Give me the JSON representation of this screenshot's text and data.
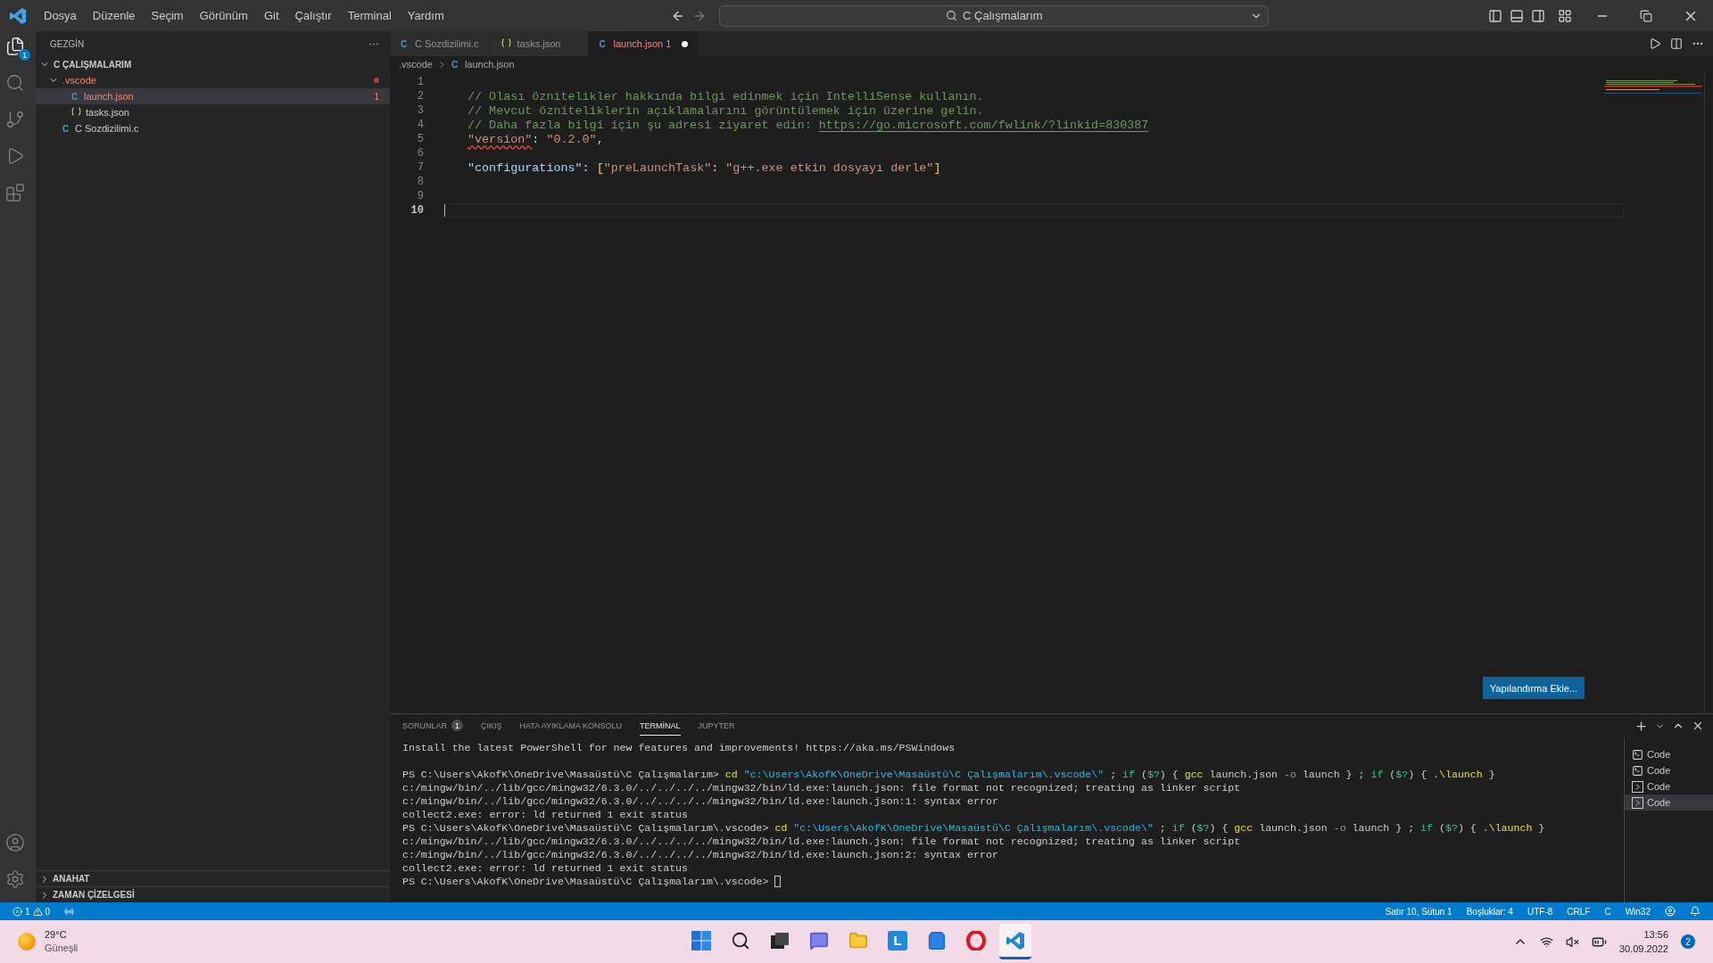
{
  "title_bar": {
    "menu": [
      "Dosya",
      "Düzenle",
      "Seçim",
      "Görünüm",
      "Git",
      "Çalıştır",
      "Terminal",
      "Yardım"
    ],
    "search": "C Çalışmalarım"
  },
  "activity_bar": {
    "items": [
      {
        "kind": "files",
        "selected": true,
        "badge": "1"
      },
      {
        "kind": "search",
        "selected": false
      },
      {
        "kind": "git",
        "selected": false
      },
      {
        "kind": "debug",
        "selected": false
      },
      {
        "kind": "extensions",
        "selected": false
      }
    ]
  },
  "sidebar": {
    "title": "GEZGİN",
    "more": "···",
    "root": {
      "label": "C ÇALIŞMALARIM",
      "expanded": true,
      "children": [
        {
          "kind": "folder",
          "label": ".vscode",
          "expanded": true,
          "error": true,
          "children": [
            {
              "kind": "c",
              "icon": "C",
              "label": "launch.json",
              "selected": true,
              "error": true,
              "badge": "1"
            },
            {
              "kind": "json",
              "label": "tasks.json",
              "selected": false,
              "error": false
            }
          ]
        },
        {
          "kind": "c",
          "icon": "C",
          "label": "C Sozdizilimi.c",
          "selected": false,
          "error": false
        }
      ]
    },
    "sections": [
      {
        "label": "ANAHAT",
        "expanded": false
      },
      {
        "label": "ZAMAN ÇİZELGESİ",
        "expanded": false
      }
    ]
  },
  "tabs": [
    {
      "kind": "c",
      "icon": "C",
      "label": "C Sozdizilimi.c",
      "selected": false,
      "error": false,
      "modified": false
    },
    {
      "kind": "json",
      "label": "tasks.json",
      "selected": false,
      "error": false,
      "modified": false
    },
    {
      "kind": "c",
      "icon": "C",
      "label": "launch.json",
      "badge": "1",
      "selected": true,
      "error": true,
      "modified": true
    }
  ],
  "breadcrumb": [
    {
      "kind": "folder",
      "label": ".vscode"
    },
    {
      "kind": "c",
      "icon": "C",
      "label": "launch.json"
    }
  ],
  "editor": {
    "lines": [
      {
        "number": "1",
        "current": false
      },
      {
        "number": "2",
        "current": false,
        "segments": [
          {
            "kind": "comment",
            "text": "// Olası öznitelikler hakkında bilgi edinmek için IntelliSense kullanın."
          }
        ]
      },
      {
        "number": "3",
        "current": false,
        "segments": [
          {
            "kind": "comment",
            "text": "// Mevcut özniteliklerin açıklamalarını görüntülemek için üzerine gelin."
          }
        ]
      },
      {
        "number": "4",
        "current": false,
        "segments": [
          {
            "kind": "comment",
            "text": "// Daha fazla bilgi için şu adresi ziyaret edin: "
          },
          {
            "kind": "link",
            "text": "https://go.microsoft.com/fwlink/?linkid=830387"
          }
        ]
      },
      {
        "number": "5",
        "current": false,
        "segments": [
          {
            "kind": "error_key",
            "text": "\"version\""
          },
          {
            "kind": "punct",
            "text": ": "
          },
          {
            "kind": "string",
            "text": "\"0.2.0\""
          },
          {
            "kind": "punct",
            "text": ","
          }
        ]
      },
      {
        "number": "6",
        "current": false
      },
      {
        "number": "7",
        "current": false,
        "segments": [
          {
            "kind": "key",
            "text": "\"configurations\""
          },
          {
            "kind": "punct",
            "text": ": "
          },
          {
            "kind": "bracket",
            "text": "["
          },
          {
            "kind": "string",
            "text": "\"preLaunchTask\""
          },
          {
            "kind": "punct",
            "text": ": "
          },
          {
            "kind": "string",
            "text": "\"g++.exe etkin dosyayı derle\""
          },
          {
            "kind": "bracket",
            "text": "]"
          }
        ]
      },
      {
        "number": "8",
        "current": false
      },
      {
        "number": "9",
        "current": false
      },
      {
        "number": "10",
        "current": true
      }
    ],
    "action_button": "Yapılandırma Ekle..."
  },
  "panel": {
    "tabs": [
      {
        "label": "SORUNLAR",
        "badge": "1",
        "selected": false
      },
      {
        "label": "ÇIKIŞ",
        "selected": false
      },
      {
        "label": "HATA AYIKLAMA KONSOLU",
        "selected": false
      },
      {
        "label": "TERMİNAL",
        "selected": true
      },
      {
        "label": "JUPYTER",
        "selected": false
      }
    ],
    "terminal_lines": [
      {
        "kind": "text",
        "segments": [
          {
            "kind": "plain",
            "text": "Install the latest PowerShell for new features and improvements! https://aka.ms/PSWindows"
          }
        ]
      },
      {
        "kind": "blank"
      },
      {
        "kind": "text",
        "segments": [
          {
            "kind": "plain",
            "text": "PS C:\\Users\\AkofK\\OneDrive\\Masaüstü\\C Çalışmalarım> "
          },
          {
            "kind": "cmd",
            "text": "cd"
          },
          {
            "kind": "str",
            "text": " \"c:\\Users\\AkofK\\OneDrive\\Masaüstü\\C Çalışmalarım\\.vscode\\\""
          },
          {
            "kind": "plain",
            "text": " ; "
          },
          {
            "kind": "kw",
            "text": "if"
          },
          {
            "kind": "plain",
            "text": " ("
          },
          {
            "kind": "kw",
            "text": "$?"
          },
          {
            "kind": "plain",
            "text": ") { "
          },
          {
            "kind": "cmd",
            "text": "gcc"
          },
          {
            "kind": "plain",
            "text": " launch.json "
          },
          {
            "kind": "flag",
            "text": "-o"
          },
          {
            "kind": "plain",
            "text": " launch } ; "
          },
          {
            "kind": "kw",
            "text": "if"
          },
          {
            "kind": "plain",
            "text": " ("
          },
          {
            "kind": "kw",
            "text": "$?"
          },
          {
            "kind": "plain",
            "text": ") { "
          },
          {
            "kind": "cmd",
            "text": ".\\launch"
          },
          {
            "kind": "plain",
            "text": " }"
          }
        ]
      },
      {
        "kind": "text",
        "segments": [
          {
            "kind": "plain",
            "text": "c:/mingw/bin/../lib/gcc/mingw32/6.3.0/../../../../mingw32/bin/ld.exe:launch.json: file format not recognized; treating as linker script"
          }
        ]
      },
      {
        "kind": "text",
        "segments": [
          {
            "kind": "plain",
            "text": "c:/mingw/bin/../lib/gcc/mingw32/6.3.0/../../../../mingw32/bin/ld.exe:launch.json:1: syntax error"
          }
        ]
      },
      {
        "kind": "text",
        "segments": [
          {
            "kind": "plain",
            "text": "collect2.exe: error: ld returned 1 exit status"
          }
        ]
      },
      {
        "kind": "text",
        "segments": [
          {
            "kind": "plain",
            "text": "PS C:\\Users\\AkofK\\OneDrive\\Masaüstü\\C Çalışmalarım\\.vscode> "
          },
          {
            "kind": "cmd",
            "text": "cd"
          },
          {
            "kind": "str",
            "text": " \"c:\\Users\\AkofK\\OneDrive\\Masaüstü\\C Çalışmalarım\\.vscode\\\""
          },
          {
            "kind": "plain",
            "text": " ; "
          },
          {
            "kind": "kw",
            "text": "if"
          },
          {
            "kind": "plain",
            "text": " ("
          },
          {
            "kind": "kw",
            "text": "$?"
          },
          {
            "kind": "plain",
            "text": ") { "
          },
          {
            "kind": "cmd",
            "text": "gcc"
          },
          {
            "kind": "plain",
            "text": " launch.json "
          },
          {
            "kind": "flag",
            "text": "-o"
          },
          {
            "kind": "plain",
            "text": " launch } ; "
          },
          {
            "kind": "kw",
            "text": "if"
          },
          {
            "kind": "plain",
            "text": " ("
          },
          {
            "kind": "kw",
            "text": "$?"
          },
          {
            "kind": "plain",
            "text": ") { "
          },
          {
            "kind": "cmd",
            "text": ".\\launch"
          },
          {
            "kind": "plain",
            "text": " }"
          }
        ]
      },
      {
        "kind": "text",
        "segments": [
          {
            "kind": "plain",
            "text": "c:/mingw/bin/../lib/gcc/mingw32/6.3.0/../../../../mingw32/bin/ld.exe:launch.json: file format not recognized; treating as linker script"
          }
        ]
      },
      {
        "kind": "text",
        "segments": [
          {
            "kind": "plain",
            "text": "c:/mingw/bin/../lib/gcc/mingw32/6.3.0/../../../../mingw32/bin/ld.exe:launch.json:2: syntax error"
          }
        ]
      },
      {
        "kind": "text",
        "segments": [
          {
            "kind": "plain",
            "text": "collect2.exe: error: ld returned 1 exit status"
          }
        ]
      },
      {
        "kind": "text",
        "segments": [
          {
            "kind": "plain",
            "text": "PS C:\\Users\\AkofK\\OneDrive\\Masaüstü\\C Çalışmalarım\\.vscode> "
          },
          {
            "kind": "cursor"
          }
        ]
      }
    ],
    "terminals": [
      {
        "kind": "powershell",
        "label": "Code",
        "selected": false
      },
      {
        "kind": "powershell",
        "label": "Code",
        "selected": false
      },
      {
        "kind": "shell",
        "label": "Code",
        "selected": false
      },
      {
        "kind": "shell",
        "label": "Code",
        "selected": true
      }
    ]
  },
  "status_bar": {
    "errors": "1",
    "warnings": "0",
    "right": [
      "Satır 10, Sütun 1",
      "Boşluklar: 4",
      "UTF-8",
      "CRLF",
      "C",
      "Win32"
    ]
  },
  "taskbar": {
    "weather": {
      "temperature": "29°C",
      "condition": "Güneşli"
    },
    "apps": [
      {
        "kind": "windows",
        "selected": false
      },
      {
        "kind": "search",
        "selected": false
      },
      {
        "kind": "taskview",
        "selected": false
      },
      {
        "kind": "chat",
        "selected": false
      },
      {
        "kind": "explorer",
        "selected": false
      },
      {
        "kind": "letter",
        "label": "L",
        "selected": false
      },
      {
        "kind": "store",
        "selected": false
      },
      {
        "kind": "opera",
        "selected": false
      },
      {
        "kind": "vscode",
        "selected": true
      }
    ],
    "time": "13:56",
    "date": "30.09.2022",
    "notifications": "2"
  }
}
